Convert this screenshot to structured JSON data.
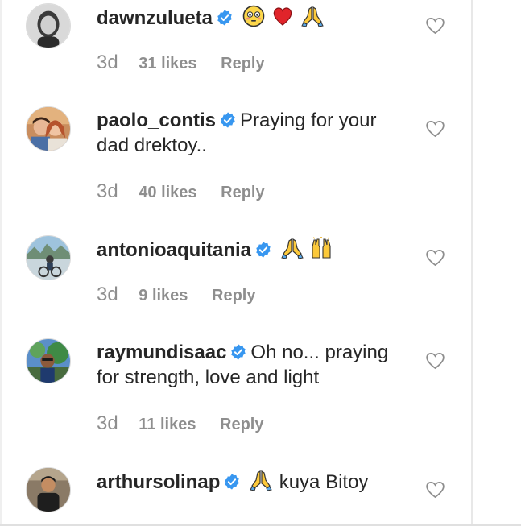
{
  "comments": [
    {
      "username": "dawnzulueta",
      "text": "",
      "emojis": [
        "flushed-face",
        "red-heart",
        "folded-hands"
      ],
      "time": "3d",
      "likes": "31 likes",
      "reply": "Reply"
    },
    {
      "username": "paolo_contis",
      "text": "Praying for your dad drektoy..",
      "time": "3d",
      "likes": "40 likes",
      "reply": "Reply"
    },
    {
      "username": "antonioaquitania",
      "text": "",
      "emojis": [
        "folded-hands",
        "raising-hands"
      ],
      "time": "3d",
      "likes": "9 likes",
      "reply": "Reply"
    },
    {
      "username": "raymundisaac",
      "text": "Oh no... praying for strength, love and light",
      "time": "3d",
      "likes": "11 likes",
      "reply": "Reply"
    },
    {
      "username": "arthursolinap",
      "text": "kuya Bitoy",
      "emojis": [
        "folded-hands"
      ],
      "time": "",
      "likes": "",
      "reply": ""
    }
  ],
  "colors": {
    "text": "#262626",
    "meta": "#8e8e8e",
    "verified": "#3897f0",
    "heart_outline": "#8e8e8e"
  },
  "icons": [
    "verified-badge-icon",
    "heart-outline-icon",
    "avatar-photo"
  ]
}
